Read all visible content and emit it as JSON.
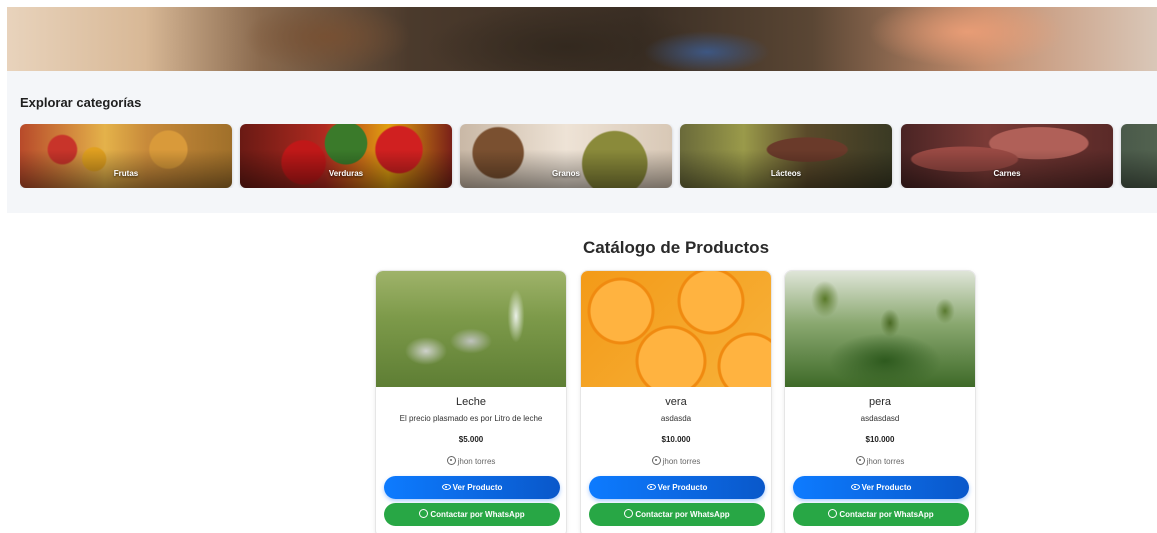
{
  "categories": {
    "heading": "Explorar categorías",
    "items": [
      {
        "label": "Frutas"
      },
      {
        "label": "Verduras"
      },
      {
        "label": "Granos"
      },
      {
        "label": "Lácteos"
      },
      {
        "label": "Carnes"
      }
    ]
  },
  "catalog": {
    "title": "Catálogo de Productos",
    "view_label": "Ver Producto",
    "whatsapp_label": "Contactar por WhatsApp",
    "products": [
      {
        "name": "Leche",
        "description": "El precio plasmado es por Litro de leche",
        "price": "$5.000",
        "seller": "jhon torres"
      },
      {
        "name": "vera",
        "description": "asdasda",
        "price": "$10.000",
        "seller": "jhon torres"
      },
      {
        "name": "pera",
        "description": "asdasdasd",
        "price": "$10.000",
        "seller": "jhon torres"
      }
    ]
  },
  "colors": {
    "primary": "#0d6efd",
    "whatsapp": "#28a745",
    "section_bg": "#f4f6f9"
  }
}
